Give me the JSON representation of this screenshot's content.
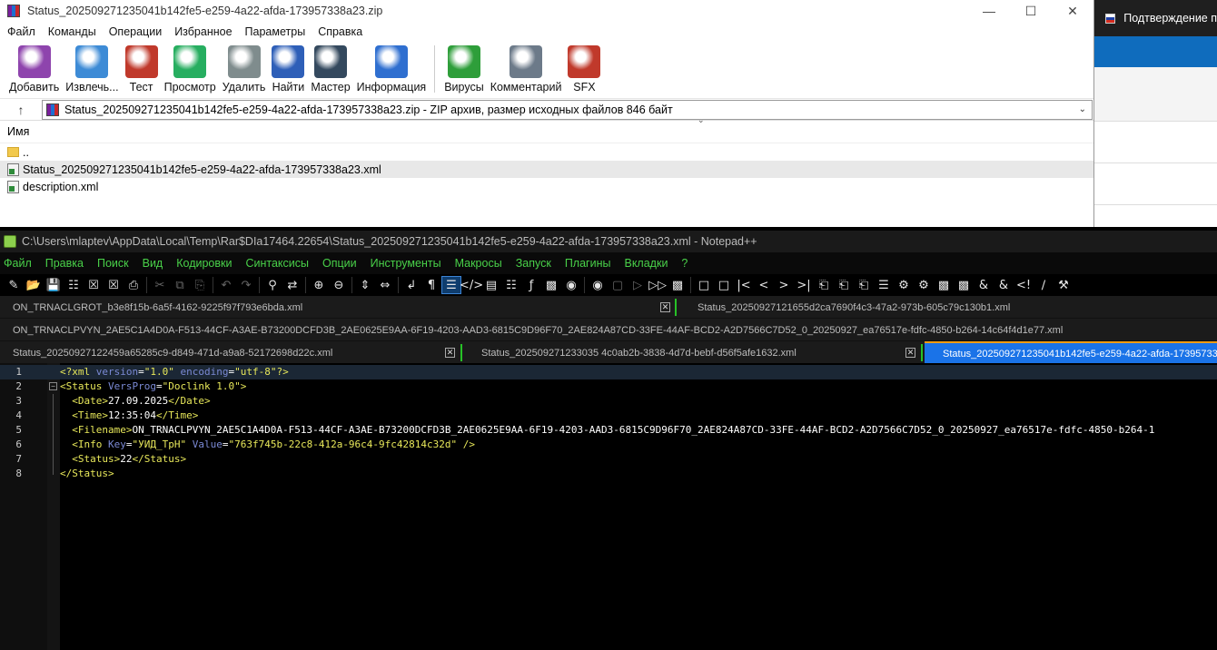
{
  "winrar": {
    "title": "Status_202509271235041b142fe5-e259-4a22-afda-173957338a23.zip",
    "menu": [
      "Файл",
      "Команды",
      "Операции",
      "Избранное",
      "Параметры",
      "Справка"
    ],
    "toolbar": [
      {
        "label": "Добавить",
        "icon": "add-archive-icon",
        "color": "#8e44ad"
      },
      {
        "label": "Извлечь...",
        "icon": "extract-folder-icon",
        "color": "#3d8bd6"
      },
      {
        "label": "Тест",
        "icon": "test-clipboard-icon",
        "color": "#c0392b"
      },
      {
        "label": "Просмотр",
        "icon": "view-book-icon",
        "color": "#27ae60"
      },
      {
        "label": "Удалить",
        "icon": "delete-trash-icon",
        "color": "#7f8c8d"
      },
      {
        "label": "Найти",
        "icon": "find-magnifier-icon",
        "color": "#2e5fb8"
      },
      {
        "label": "Мастер",
        "icon": "wizard-wand-icon",
        "color": "#34495e"
      },
      {
        "label": "Информация",
        "icon": "info-icon",
        "color": "#2f6fd0"
      },
      {
        "label": "Вирусы",
        "icon": "virus-scan-icon",
        "color": "#2e9e3a"
      },
      {
        "label": "Комментарий",
        "icon": "comment-icon",
        "color": "#6c7a89"
      },
      {
        "label": "SFX",
        "icon": "sfx-box-icon",
        "color": "#c0392b"
      }
    ],
    "address": "Status_202509271235041b142fe5-e259-4a22-afda-173957338a23.zip - ZIP архив, размер исходных файлов 846 байт",
    "column_name": "Имя",
    "files": [
      {
        "name": "..",
        "type": "folder"
      },
      {
        "name": "Status_202509271235041b142fe5-e259-4a22-afda-173957338a23.xml",
        "type": "xml"
      },
      {
        "name": "description.xml",
        "type": "xml"
      }
    ]
  },
  "background_window": {
    "title": "Подтверждение п"
  },
  "npp": {
    "title": "C:\\Users\\mlaptev\\AppData\\Local\\Temp\\Rar$DIa17464.22654\\Status_202509271235041b142fe5-e259-4a22-afda-173957338a23.xml - Notepad++",
    "menu": [
      "Файл",
      "Правка",
      "Поиск",
      "Вид",
      "Кодировки",
      "Синтаксисы",
      "Опции",
      "Инструменты",
      "Макросы",
      "Запуск",
      "Плагины",
      "Вкладки",
      "?"
    ],
    "tabs_row1": [
      "ON_TRNACLGROT_b3e8f15b-6a5f-4162-9225f97f793e6bda.xml",
      "Status_20250927121655d2ca7690f4c3-47a2-973b-605c79c130b1.xml"
    ],
    "tabs_row2": [
      "ON_TRNACLPVYN_2AE5C1A4D0A-F513-44CF-A3AE-B73200DCFD3B_2AE0625E9AA-6F19-4203-AAD3-6815C9D96F70_2AE824A87CD-33FE-44AF-BCD2-A2D7566C7D52_0_20250927_ea76517e-fdfc-4850-b264-14c64f4d1e77.xml"
    ],
    "tabs_row3": [
      "Status_20250927122459a65285c9-d849-471d-a9a8-52172698d22c.xml",
      "Status_202509271233035 4c0ab2b-3838-4d7d-bebf-d56f5afe1632.xml",
      "Status_202509271235041b142fe5-e259-4a22-afda-173957338a"
    ],
    "lines": [
      "1",
      "2",
      "3",
      "4",
      "5",
      "6",
      "7",
      "8"
    ],
    "xml": {
      "decl_version": "\"1.0\"",
      "decl_encoding": "\"utf-8\"",
      "versprog": "\"Doclink 1.0\"",
      "date": "27.09.2025",
      "time": "12:35:04",
      "filename": "ON_TRNACLPVYN_2AE5C1A4D0A-F513-44CF-A3AE-B73200DCFD3B_2AE0625E9AA-6F19-4203-AAD3-6815C9D96F70_2AE824A87CD-33FE-44AF-BCD2-A2D7566C7D52_0_20250927_ea76517e-fdfc-4850-b264-1",
      "info_key": "\"УИД_ТрН\"",
      "info_value": "\"763f745b-22c8-412a-96c4-9fc42814c32d\"",
      "status": "22"
    }
  }
}
